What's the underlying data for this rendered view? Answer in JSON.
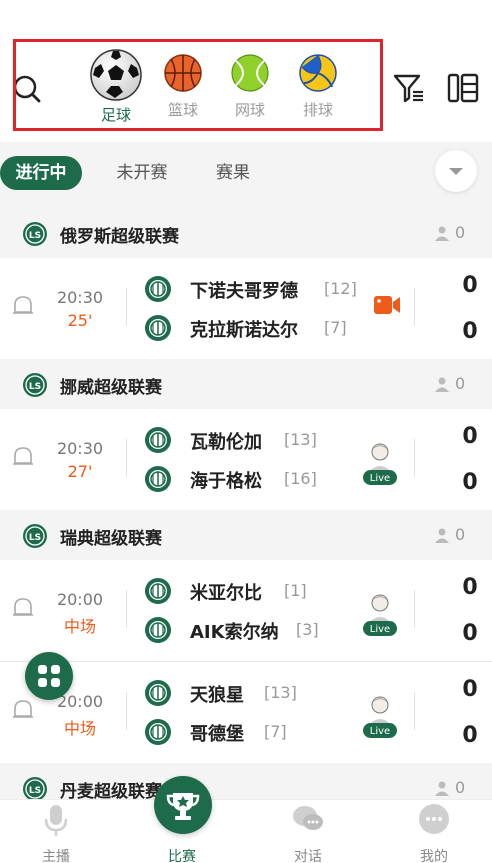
{
  "sports": [
    {
      "label": "足球",
      "icon": "soccer-ball-icon",
      "active": true
    },
    {
      "label": "篮球",
      "icon": "basketball-icon",
      "active": false
    },
    {
      "label": "网球",
      "icon": "tennis-ball-icon",
      "active": false
    },
    {
      "label": "排球",
      "icon": "volleyball-icon",
      "active": false
    }
  ],
  "tabs": [
    {
      "label": "进行中",
      "active": true
    },
    {
      "label": "未开赛",
      "active": false
    },
    {
      "label": "赛果",
      "active": false
    }
  ],
  "leagues": [
    {
      "name": "俄罗斯超级联赛",
      "count": "0",
      "matches": [
        {
          "time": "20:30",
          "status": "25'",
          "home": {
            "name": "下诺夫哥罗德",
            "rank": "[12]"
          },
          "away": {
            "name": "克拉斯诺达尔",
            "rank": "[7]"
          },
          "home_score": "0",
          "away_score": "0",
          "media": "video"
        }
      ]
    },
    {
      "name": "挪威超级联赛",
      "count": "0",
      "matches": [
        {
          "time": "20:30",
          "status": "27'",
          "home": {
            "name": "瓦勒伦加",
            "rank": "[13]"
          },
          "away": {
            "name": "海于格松",
            "rank": "[16]"
          },
          "home_score": "0",
          "away_score": "0",
          "media": "live"
        }
      ]
    },
    {
      "name": "瑞典超级联赛",
      "count": "0",
      "matches": [
        {
          "time": "20:00",
          "status": "中场",
          "home": {
            "name": "米亚尔比",
            "rank": "[1]"
          },
          "away": {
            "name": "AIK索尔纳",
            "rank": "[3]"
          },
          "home_score": "0",
          "away_score": "0",
          "media": "live"
        },
        {
          "time": "20:00",
          "status": "中场",
          "home": {
            "name": "天狼星",
            "rank": "[13]"
          },
          "away": {
            "name": "哥德堡",
            "rank": "[7]"
          },
          "home_score": "0",
          "away_score": "0",
          "media": "live"
        }
      ]
    },
    {
      "name": "丹麦超级联赛",
      "count": "0",
      "matches": []
    }
  ],
  "live_badge": "Live",
  "bottom_nav": [
    {
      "label": "主播",
      "icon": "microphone-icon",
      "active": false
    },
    {
      "label": "比赛",
      "icon": "trophy-icon",
      "active": true
    },
    {
      "label": "对话",
      "icon": "chat-icon",
      "active": false
    },
    {
      "label": "我的",
      "icon": "profile-icon",
      "active": false
    }
  ],
  "colors": {
    "brand": "#1e6b4c",
    "live_time": "#f05a1a",
    "highlight_border": "#e0242c",
    "video": "#f05a1a"
  }
}
